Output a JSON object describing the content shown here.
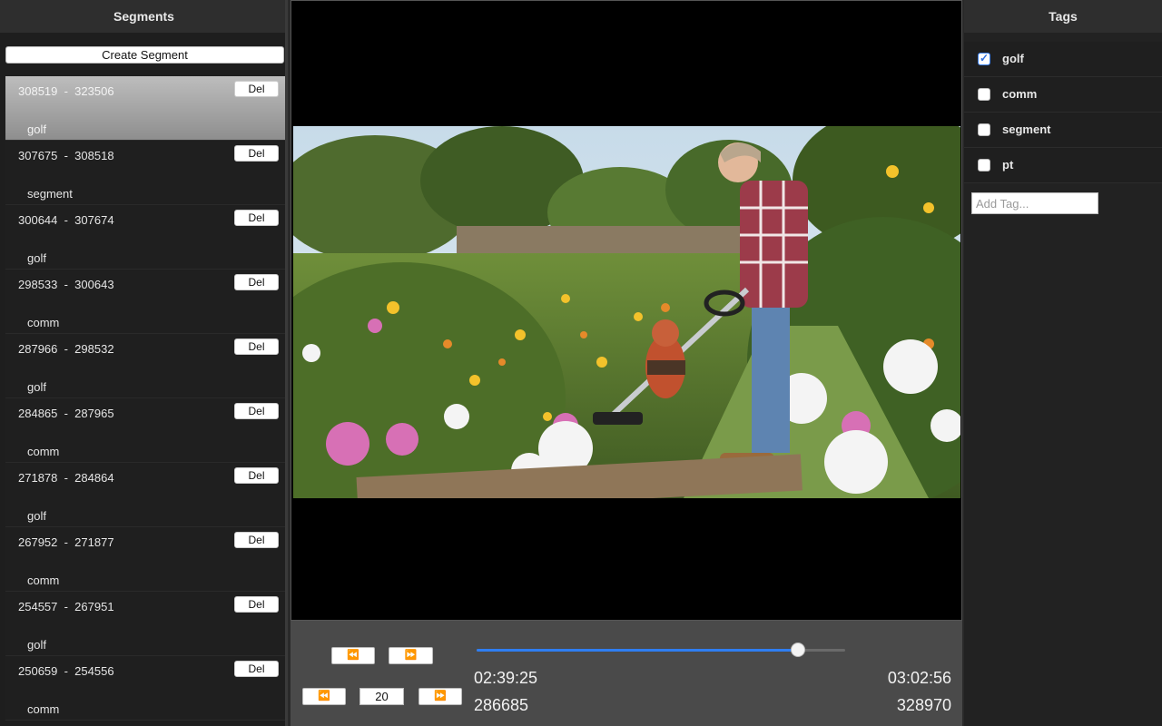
{
  "segments_panel": {
    "title": "Segments",
    "create_label": "Create Segment",
    "del_label": "Del",
    "items": [
      {
        "start": "308519",
        "end": "323506",
        "tag": "golf",
        "selected": true
      },
      {
        "start": "307675",
        "end": "308518",
        "tag": "segment"
      },
      {
        "start": "300644",
        "end": "307674",
        "tag": "golf"
      },
      {
        "start": "298533",
        "end": "300643",
        "tag": "comm"
      },
      {
        "start": "287966",
        "end": "298532",
        "tag": "golf"
      },
      {
        "start": "284865",
        "end": "287965",
        "tag": "comm"
      },
      {
        "start": "271878",
        "end": "284864",
        "tag": "golf"
      },
      {
        "start": "267952",
        "end": "271877",
        "tag": "comm"
      },
      {
        "start": "254557",
        "end": "267951",
        "tag": "golf"
      },
      {
        "start": "250659",
        "end": "254556",
        "tag": "comm"
      }
    ]
  },
  "controls": {
    "rewind_icon": "⏪",
    "forward_icon": "⏩",
    "step_value": "20",
    "progress": 0.872,
    "current_time": "02:39:25",
    "total_time": "03:02:56",
    "current_frame": "286685",
    "total_frames": "328970",
    "accent": "#2f7ef2"
  },
  "tags_panel": {
    "title": "Tags",
    "items": [
      {
        "label": "golf",
        "checked": true
      },
      {
        "label": "comm",
        "checked": false
      },
      {
        "label": "segment",
        "checked": false
      },
      {
        "label": "pt",
        "checked": false
      }
    ],
    "add_placeholder": "Add Tag..."
  }
}
